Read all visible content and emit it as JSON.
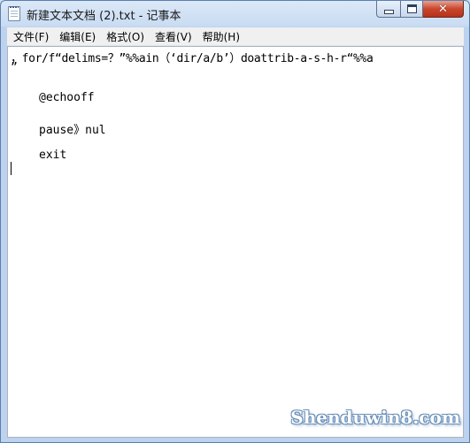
{
  "window": {
    "title": "新建文本文档 (2).txt - 记事本",
    "icon": "notepad-icon",
    "controls": {
      "minimize": "minimize-icon",
      "maximize": "maximize-icon",
      "close": "close-icon",
      "close_glyph": "✕"
    }
  },
  "menu": [
    {
      "label": "文件(F)"
    },
    {
      "label": "编辑(E)"
    },
    {
      "label": "格式(O)"
    },
    {
      "label": "查看(V)"
    },
    {
      "label": "帮助(H)"
    }
  ],
  "editor": {
    "lines": [
      "，for/f“delims=？”%%ain（‘dir/a/b’）doattrib-a-s-h-r“%%a",
      "”",
      "@echooff",
      "pause》nul",
      "exit"
    ]
  },
  "watermark": "Shenduwin8.com"
}
